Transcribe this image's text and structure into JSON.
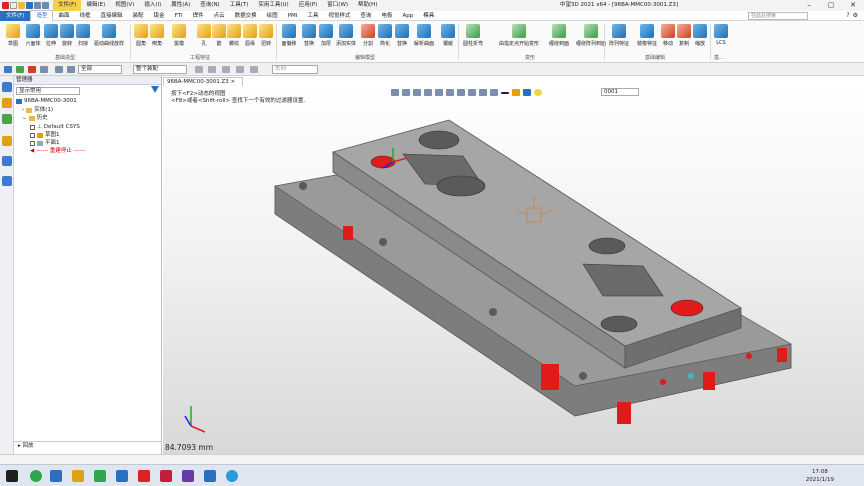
{
  "app": {
    "title": "中望3D 2021 x64 - [96BA-MMC00-3001.Z3]",
    "menu": [
      "文件(F)",
      "编辑(E)",
      "视图(V)",
      "插入(I)",
      "属性(A)",
      "查询(N)",
      "工具(T)",
      "实用工具(U)",
      "应用(P)",
      "窗口(W)",
      "帮助(H)"
    ]
  },
  "tabs": {
    "file": "文件(F)",
    "items": [
      "造型",
      "曲面",
      "线框",
      "直接编辑",
      "装配",
      "钣金",
      "FTI",
      "焊件",
      "点云",
      "数据交换",
      "绘图",
      "PMI",
      "工具",
      "视觉样式",
      "查询",
      "电极",
      "App",
      "模具"
    ],
    "search_placeholder": "在此处搜索"
  },
  "ribbon": {
    "tools": [
      "草图",
      "六面体",
      "拉伸",
      "旋转",
      "扫掠",
      "驱动曲线放样",
      "圆角",
      "倒角",
      "拔模",
      "孔",
      "筋",
      "螺纹",
      "唇缘",
      "扭转",
      "面偏移",
      "替换",
      "加厚",
      "添加实体",
      "分割",
      "简化",
      "替换",
      "解析曲面",
      "镶嵌",
      "圆柱折弯",
      "由指定点开始变形",
      "缠绕到面",
      "缠绕阵列到面",
      "阵列特征",
      "镜像特征",
      "移动",
      "复制",
      "缩放",
      "LCS"
    ],
    "groups": [
      "基础造型",
      "工程特征",
      "编辑模型",
      "变形",
      "基础编辑",
      "基..."
    ]
  },
  "toolbar": {
    "filter_value": "全部",
    "filter2_value": "整个装配",
    "input_placeholder": "去向"
  },
  "manager": {
    "title": "管理器",
    "filter_value": "显示常用",
    "tree": [
      {
        "label": "96BA-MMC00-3001",
        "level": 0
      },
      {
        "label": "实体(1)",
        "level": 1
      },
      {
        "label": "历史",
        "level": 1
      },
      {
        "label": "Default CSYS",
        "level": 2
      },
      {
        "label": "草图1",
        "level": 2
      },
      {
        "label": "平面1",
        "level": 2
      },
      {
        "label": "------ 重建停止 ------",
        "level": 2
      }
    ],
    "bottom": "回放"
  },
  "document_tab": "96BA-MMC00-3001.Z3",
  "viewport": {
    "hint1": "按下<F2>动态的视图",
    "hint2": "<F8>或者<Shift-roll> 查找下一个有效的过滤器设置.",
    "combo_value": "0001",
    "measure": "84.7093 mm"
  },
  "taskbar": {
    "time": "17:08",
    "date": "2021/1/19"
  },
  "colors": {
    "accent": "#2b6fc2",
    "part_gray": "#8c8c8c",
    "hole_red": "#e11a1a",
    "highlight": "#f6d24a"
  }
}
